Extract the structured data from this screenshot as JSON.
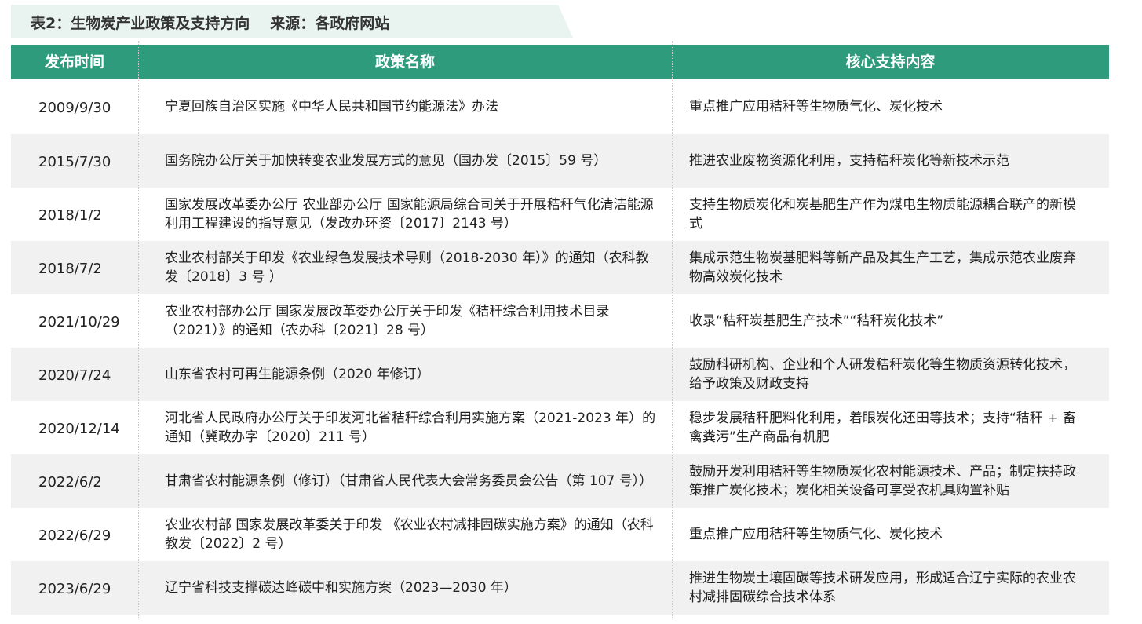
{
  "caption": {
    "title": "表2：生物炭产业政策及支持方向",
    "source": "来源：各政府网站"
  },
  "table": {
    "headers": [
      "发布时间",
      "政策名称",
      "核心支持内容"
    ],
    "rows": [
      [
        "2009/9/30",
        "宁夏回族自治区实施《中华人民共和国节约能源法》办法",
        "重点推广应用秸秆等生物质气化、炭化技术"
      ],
      [
        "2015/7/30",
        "国务院办公厅关于加快转变农业发展方式的意见（国办发〔2015〕59 号）",
        "推进农业废物资源化利用，支持秸秆炭化等新技术示范"
      ],
      [
        "2018/1/2",
        "国家发展改革委办公厅 农业部办公厅 国家能源局综合司关于开展秸秆气化清洁能源利用工程建设的指导意见（发改办环资〔2017〕2143 号）",
        "支持生物质炭化和炭基肥生产作为煤电生物质能源耦合联产的新模式"
      ],
      [
        "2018/7/2",
        "农业农村部关于印发《农业绿色发展技术导则（2018-2030 年）》的通知（农科教发〔2018〕3 号 ）",
        "集成示范生物炭基肥料等新产品及其生产工艺，集成示范农业废弃物高效炭化技术"
      ],
      [
        "2021/10/29",
        "农业农村部办公厅 国家发展改革委办公厅关于印发《秸秆综合利用技术目录（2021）》的通知（农办科〔2021〕28 号）",
        "收录“秸秆炭基肥生产技术”“秸秆炭化技术”"
      ],
      [
        "2020/7/24",
        "山东省农村可再生能源条例（2020 年修订）",
        "鼓励科研机构、企业和个人研发秸秆炭化等生物质资源转化技术，给予政策及财政支持"
      ],
      [
        "2020/12/14",
        "河北省人民政府办公厅关于印发河北省秸秆综合利用实施方案（2021-2023 年）的通知（冀政办字〔2020〕211 号）",
        "稳步发展秸秆肥料化利用，着眼炭化还田等技术；支持“秸秆 + 畜禽粪污”生产商品有机肥"
      ],
      [
        "2022/6/2",
        "甘肃省农村能源条例（修订）（甘肃省人民代表大会常务委员会公告（第 107 号））",
        "鼓励开发利用秸秆等生物质炭化农村能源技术、产品；制定扶持政策推广炭化技术；炭化相关设备可享受农机具购置补贴"
      ],
      [
        "2022/6/29",
        "农业农村部 国家发展改革委关于印发 《农业农村减排固碳实施方案》的通知（农科教发〔2022〕2 号）",
        "重点推广应用秸秆等生物质气化、炭化技术"
      ],
      [
        "2023/6/29",
        "辽宁省科技支撑碳达峰碳中和实施方案（2023—2030 年）",
        "推进生物炭土壤固碳等技术研发应用，形成适合辽宁实际的农业农村减排固碳综合技术体系"
      ]
    ]
  }
}
